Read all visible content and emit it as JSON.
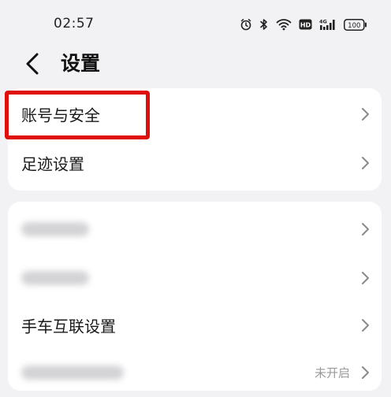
{
  "status_bar": {
    "time": "02:57",
    "icons": [
      "alarm-icon",
      "bluetooth-icon",
      "wifi-icon",
      "hd-icon",
      "signal-icon",
      "battery-icon"
    ],
    "hd_label": "HD",
    "network_label": "4G",
    "battery_label": "100"
  },
  "header": {
    "title": "设置"
  },
  "card1": {
    "items": [
      {
        "label": "账号与安全"
      },
      {
        "label": "足迹设置"
      }
    ]
  },
  "card2": {
    "items": [
      {
        "label": ""
      },
      {
        "label": ""
      },
      {
        "label": "手车互联设置"
      },
      {
        "label": "",
        "value": "未开启"
      }
    ]
  },
  "colors": {
    "highlight": "#e00d0d",
    "background": "#f2f2f4",
    "card": "#ffffff",
    "chevron": "#8a8a8a"
  }
}
